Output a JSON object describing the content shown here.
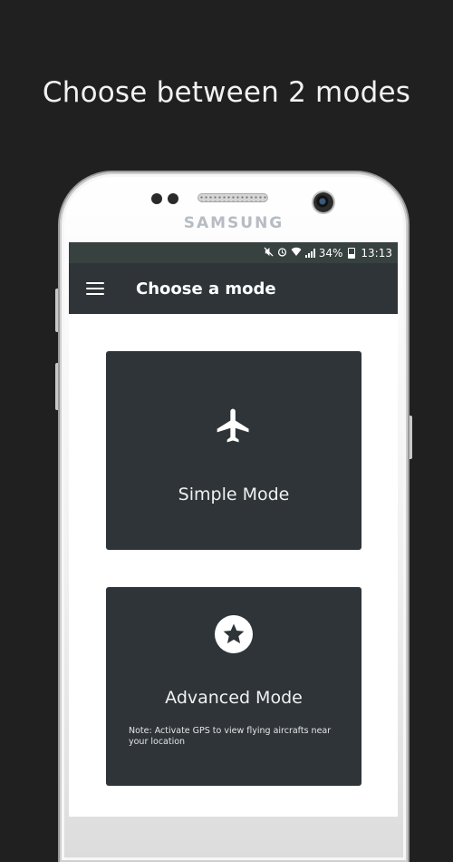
{
  "promo": {
    "title": "Choose between 2 modes"
  },
  "device": {
    "brand": "SAMSUNG"
  },
  "status_bar": {
    "battery": "34%",
    "time": "13:13"
  },
  "app_bar": {
    "title": "Choose a mode"
  },
  "modes": {
    "simple": {
      "label": "Simple Mode",
      "icon": "airplane-icon"
    },
    "advanced": {
      "label": "Advanced Mode",
      "icon": "star-circle-icon",
      "note": "Note: Activate GPS to view flying aircrafts near your location"
    }
  },
  "colors": {
    "background": "#202020",
    "app_bar": "#2e3438",
    "card": "#2e3438",
    "status_bar": "#37413f"
  }
}
